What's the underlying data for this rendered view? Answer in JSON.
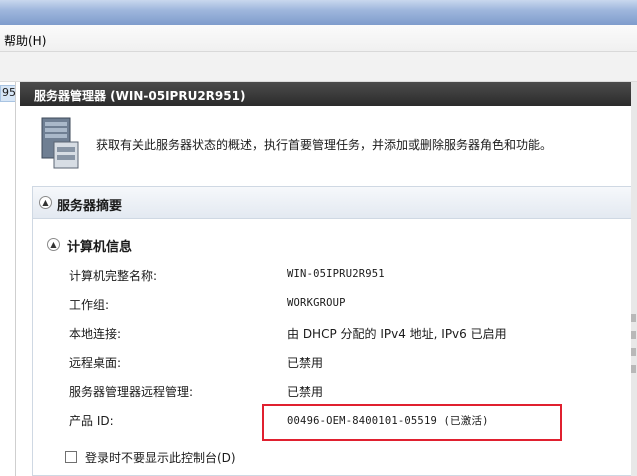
{
  "menu": {
    "help_label": "帮助(H)"
  },
  "tree": {
    "node_label": "95"
  },
  "pane": {
    "title": "服务器管理器 (WIN-05IPRU2R951)"
  },
  "banner": {
    "icon": "server-icon",
    "text": "获取有关此服务器状态的概述，执行首要管理任务，并添加或删除服务器角色和功能。"
  },
  "summary": {
    "title": "服务器摘要",
    "computer_info": {
      "title": "计算机信息",
      "rows": [
        {
          "label": "计算机完整名称:",
          "value": "WIN-05IPRU2R951"
        },
        {
          "label": "工作组:",
          "value": "WORKGROUP"
        },
        {
          "label": "本地连接:",
          "value": "由 DHCP 分配的 IPv4 地址, IPv6 已启用"
        },
        {
          "label": "远程桌面:",
          "value": "已禁用"
        },
        {
          "label": "服务器管理器远程管理:",
          "value": "已禁用"
        },
        {
          "label": "产品 ID:",
          "value": "00496-OEM-8400101-05519 (已激活)"
        }
      ]
    },
    "checkbox_label": "登录时不要显示此控制台(D)"
  },
  "colors": {
    "highlight": "#e0202f",
    "header_dark": "#2b2b2b",
    "accent": "#1f4e9c"
  }
}
